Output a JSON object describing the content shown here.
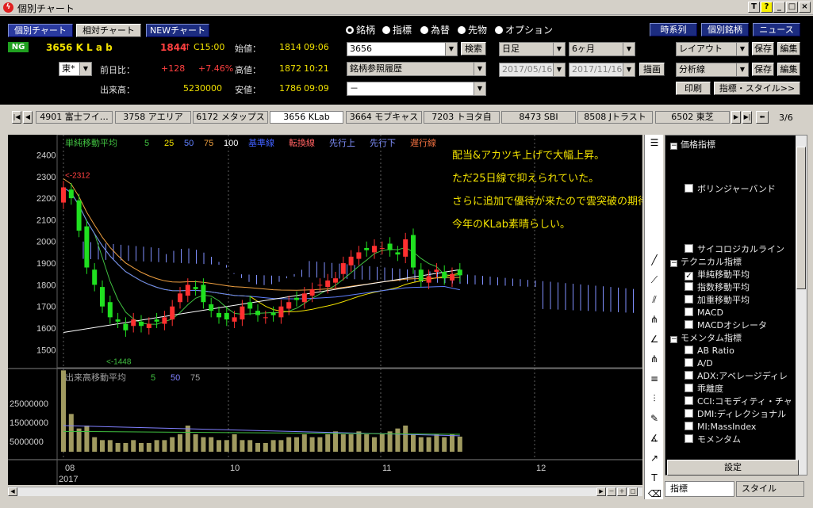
{
  "window": {
    "title": "個別チャート",
    "help_label": "?",
    "t_label": "T"
  },
  "top": {
    "mode_buttons": [
      "個別チャート",
      "相対チャート",
      "NEWチャート"
    ],
    "ng_label": "NG",
    "ticker": "3656 K L a b",
    "price": "1844",
    "price_arrow": "↑",
    "price_time": "C15:00",
    "open_label": "始値：",
    "open_value": "1814",
    "open_time": "09:06",
    "prev_ratio_label": "前日比：",
    "prev_diff": "+128",
    "prev_pct": "+7.46%",
    "high_label": "高値：",
    "high_value": "1872",
    "high_time": "10:21",
    "volume_label": "出来高：",
    "volume_value": "5230000",
    "low_label": "安値：",
    "low_value": "1786",
    "low_time": "09:09",
    "market_select": "東*",
    "asset_radios": [
      "銘柄",
      "指標",
      "為替",
      "先物",
      "オプション"
    ],
    "code_input": "3656",
    "search_button": "検索",
    "history_select": "銘柄参照履歴",
    "blank_select": "－",
    "period_select": "日足",
    "range_select": "6ヶ月",
    "date_from": "2017/05/16",
    "date_to": "2017/11/16",
    "draw_button": "描画",
    "right_buttons": [
      "時系列",
      "個別銘柄",
      "ニュース"
    ],
    "layout_select": "レイアウト",
    "analysis_select": "分析線",
    "save_label": "保存",
    "edit_label": "編集",
    "print_label": "印刷",
    "indicator_style_label": "指標・スタイル>>"
  },
  "tabs": {
    "items": [
      "4901 富士フイ…",
      "3758 アエリア",
      "6172 メタップス",
      "3656 KLab",
      "3664 モブキャス",
      "7203 トヨタ自",
      "8473 SBI",
      "8508 Jトラスト",
      "6502 東芝"
    ],
    "active": 3,
    "page": "3/6"
  },
  "chart": {
    "legend_label": "単純移動平均",
    "legend_periods": [
      "5",
      "25",
      "50",
      "75",
      "100"
    ],
    "ichimoku": [
      "基準線",
      "転換線",
      "先行上",
      "先行下",
      "遅行線"
    ],
    "annotation": [
      "配当&アカツキ上げで大幅上昇。",
      "ただ25日線で抑えられていた。",
      "さらに追加で優待が来たので雲突破の期待大です。",
      "今年のKLab素晴らしい。"
    ],
    "high_mark": "<-2312",
    "low_mark": "<-1448",
    "y_ticks": [
      "2400",
      "2300",
      "2200",
      "2100",
      "2000",
      "1900",
      "1800",
      "1700",
      "1600",
      "1500"
    ],
    "vol_legend_label": "出来高移動平均",
    "vol_legend_periods": [
      "5",
      "50",
      "75"
    ],
    "vol_ticks": [
      "25000000",
      "15000000",
      "5000000"
    ],
    "x_ticks": [
      "08",
      "10",
      "11",
      "12"
    ],
    "year": "2017"
  },
  "chart_data": {
    "type": "candlestick",
    "y_unit": "JPY",
    "ylim": [
      1400,
      2450
    ],
    "title": "",
    "candles_close_est": [
      2250,
      2200,
      2050,
      1880,
      1800,
      1700,
      1650,
      1630,
      1590,
      1640,
      1610,
      1620,
      1630,
      1650,
      1700,
      1760,
      1800,
      1780,
      1720,
      1680,
      1650,
      1640,
      1650,
      1700,
      1690,
      1660,
      1650,
      1660,
      1700,
      1720,
      1730,
      1760,
      1780,
      1800,
      1820,
      1830,
      1900,
      1930,
      1950,
      1960,
      1980,
      1970,
      1960,
      1940,
      2010,
      1880,
      1820,
      1840,
      1870,
      1830,
      1850,
      1844
    ],
    "volume_ma_periods": [
      5,
      50,
      75
    ]
  },
  "side": {
    "tree": [
      {
        "type": "group",
        "label": "価格指標"
      },
      {
        "type": "item",
        "label": "ボリンジャーバンド",
        "checked": false
      },
      {
        "type": "item",
        "label": "サイコロジカルライン",
        "checked": false
      },
      {
        "type": "group",
        "label": "テクニカル指標"
      },
      {
        "type": "item",
        "label": "単純移動平均",
        "checked": true
      },
      {
        "type": "item",
        "label": "指数移動平均",
        "checked": false
      },
      {
        "type": "item",
        "label": "加重移動平均",
        "checked": false
      },
      {
        "type": "item",
        "label": "MACD",
        "checked": false
      },
      {
        "type": "item",
        "label": "MACDオシレータ",
        "checked": false
      },
      {
        "type": "group",
        "label": "モメンタム指標"
      },
      {
        "type": "item",
        "label": "AB Ratio",
        "checked": false
      },
      {
        "type": "item",
        "label": "A/D",
        "checked": false
      },
      {
        "type": "item",
        "label": "ADX:アベレージディレ",
        "checked": false
      },
      {
        "type": "item",
        "label": "乖離度",
        "checked": false
      },
      {
        "type": "item",
        "label": "CCI:コモディティ・チャ",
        "checked": false
      },
      {
        "type": "item",
        "label": "DMI:ディレクショナル",
        "checked": false
      },
      {
        "type": "item",
        "label": "MI:MassIndex",
        "checked": false
      },
      {
        "type": "item",
        "label": "モメンタム",
        "checked": false
      }
    ],
    "settings_button": "設定",
    "bottom_tabs": [
      "指標",
      "スタイル"
    ]
  }
}
